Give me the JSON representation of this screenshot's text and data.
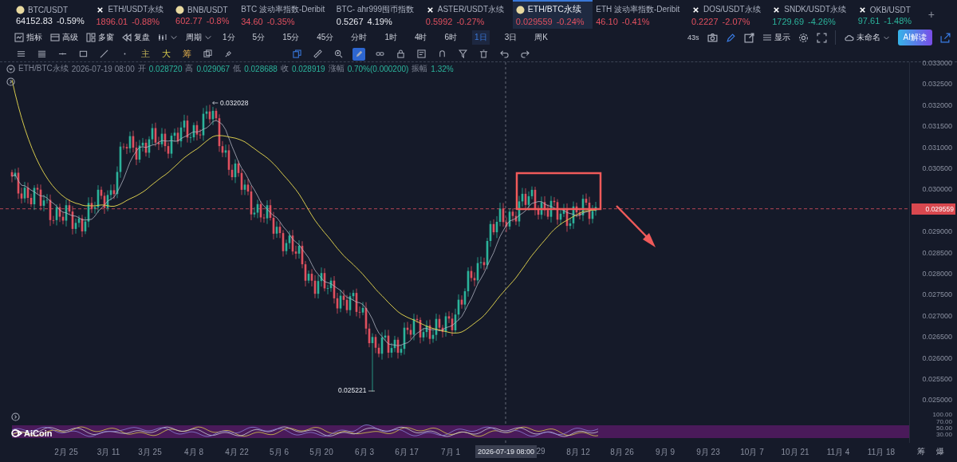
{
  "tabs": [
    {
      "kind": "coin",
      "name": "BTC/USDT",
      "price": "64152.83",
      "change": "-0.59%",
      "color": "#e8eaf0",
      "selected": false
    },
    {
      "kind": "cross",
      "name": "ETH/USDT永续",
      "price": "1896.01",
      "change": "-0.88%",
      "color": "#e0505f",
      "selected": false
    },
    {
      "kind": "coin",
      "name": "BNB/USDT",
      "price": "602.77",
      "change": "-0.8%",
      "color": "#e0505f",
      "selected": false
    },
    {
      "kind": "plain",
      "name": "BTC 波动率指数-Deribit",
      "price": "34.60",
      "change": "-0.35%",
      "color": "#e0505f",
      "selected": false
    },
    {
      "kind": "plain",
      "name": "BTC- ahr999囤币指数",
      "price": "0.5267",
      "change": "4.19%",
      "color": "#e8eaf0",
      "selected": false
    },
    {
      "kind": "cross",
      "name": "ASTER/USDT永续",
      "price": "0.5992",
      "change": "-0.27%",
      "color": "#e0505f",
      "selected": false
    },
    {
      "kind": "coin",
      "name": "ETH/BTC永续",
      "price": "0.029559",
      "change": "-0.24%",
      "color": "#e0505f",
      "selected": true
    },
    {
      "kind": "plain",
      "name": "ETH 波动率指数-Deribit",
      "price": "46.10",
      "change": "-0.41%",
      "color": "#e0505f",
      "selected": false
    },
    {
      "kind": "cross",
      "name": "DOS/USDT永续",
      "price": "0.2227",
      "change": "-2.07%",
      "color": "#e0505f",
      "selected": false
    },
    {
      "kind": "cross",
      "name": "SNDK/USDT永续",
      "price": "1729.69",
      "change": "-4.26%",
      "color": "#2bb39b",
      "selected": false
    },
    {
      "kind": "cross",
      "name": "OKB/USDT",
      "price": "97.61",
      "change": "-1.48%",
      "color": "#2bb39b",
      "selected": false
    }
  ],
  "add_tab": "+",
  "toolbar": {
    "menus": [
      {
        "label": "指标"
      },
      {
        "label": "高级"
      },
      {
        "label": "多窗"
      },
      {
        "label": "复盘"
      }
    ],
    "period": "周期",
    "intervals": [
      {
        "label": "1分",
        "selected": false
      },
      {
        "label": "5分",
        "selected": false
      },
      {
        "label": "15分",
        "selected": false
      },
      {
        "label": "45分",
        "selected": false
      },
      {
        "label": "分时",
        "selected": false
      },
      {
        "label": "1时",
        "selected": false
      },
      {
        "label": "4时",
        "selected": false
      },
      {
        "label": "6时",
        "selected": false
      },
      {
        "label": "1日",
        "selected": true
      },
      {
        "label": "3日",
        "selected": false
      },
      {
        "label": "周K",
        "selected": false
      }
    ],
    "timer": "43s",
    "display": "显示",
    "layout": "未命名",
    "ai_button": "AI解读"
  },
  "tools": [
    {
      "kind": "icon",
      "selected": false
    },
    {
      "kind": "icon",
      "selected": false
    },
    {
      "kind": "icon",
      "selected": false
    },
    {
      "kind": "icon",
      "selected": false
    },
    {
      "kind": "icon",
      "selected": false
    },
    {
      "kind": "icon",
      "selected": false
    },
    {
      "kind": "letter",
      "label": "主",
      "selected": false
    },
    {
      "kind": "letter",
      "label": "大",
      "selected": false
    },
    {
      "kind": "letter",
      "label": "筹",
      "selected": false
    },
    {
      "kind": "icon",
      "selected": false
    },
    {
      "kind": "icon",
      "selected": false
    },
    {
      "kind": "gap"
    },
    {
      "kind": "icon",
      "selected": false
    },
    {
      "kind": "icon",
      "selected": false
    },
    {
      "kind": "icon",
      "selected": false
    },
    {
      "kind": "icon",
      "selected": true
    },
    {
      "kind": "icon",
      "selected": false
    },
    {
      "kind": "icon",
      "selected": false
    },
    {
      "kind": "icon",
      "selected": false
    },
    {
      "kind": "icon",
      "selected": false
    },
    {
      "kind": "icon",
      "selected": false
    },
    {
      "kind": "icon",
      "selected": false
    },
    {
      "kind": "icon",
      "selected": false
    },
    {
      "kind": "icon",
      "selected": false
    }
  ],
  "info": {
    "symbol": "ETH/BTC永续",
    "time": "2026-07-19 08:00",
    "fields": [
      {
        "label": "开",
        "value": "0.028720"
      },
      {
        "label": "高",
        "value": "0.029067"
      },
      {
        "label": "低",
        "value": "0.028688"
      },
      {
        "label": "收",
        "value": "0.028919"
      },
      {
        "label": "涨幅",
        "value": "0.70%(0.000200)"
      },
      {
        "label": "振幅",
        "value": "1.32%"
      }
    ]
  },
  "chart": {
    "high_label": "0.032028",
    "low_label": "0.025221",
    "current_price": "0.029559",
    "price_axis": [
      "0.033000",
      "0.032500",
      "0.032000",
      "0.031500",
      "0.031000",
      "0.030500",
      "0.030000",
      "0.029000",
      "0.028500",
      "0.028000",
      "0.027500",
      "0.027000",
      "0.026500",
      "0.026000",
      "0.025500",
      "0.025000"
    ],
    "oscillator_axis": [
      "100.00",
      "70.00",
      "50.00",
      "30.00"
    ],
    "time_axis": [
      "2月 25",
      "3月 11",
      "3月 25",
      "4月 8",
      "4月 22",
      "5月 6",
      "5月 20",
      "6月 3",
      "6月 17",
      "7月 1",
      "29",
      "8月 12",
      "8月 26",
      "9月 9",
      "9月 23",
      "10月 7",
      "10月 21",
      "11月 4",
      "11月 18"
    ],
    "crosshair_time": "2026-07-19 08:00",
    "watermark": "AiCoin",
    "footer_buttons": [
      "筹",
      "爆"
    ]
  }
}
